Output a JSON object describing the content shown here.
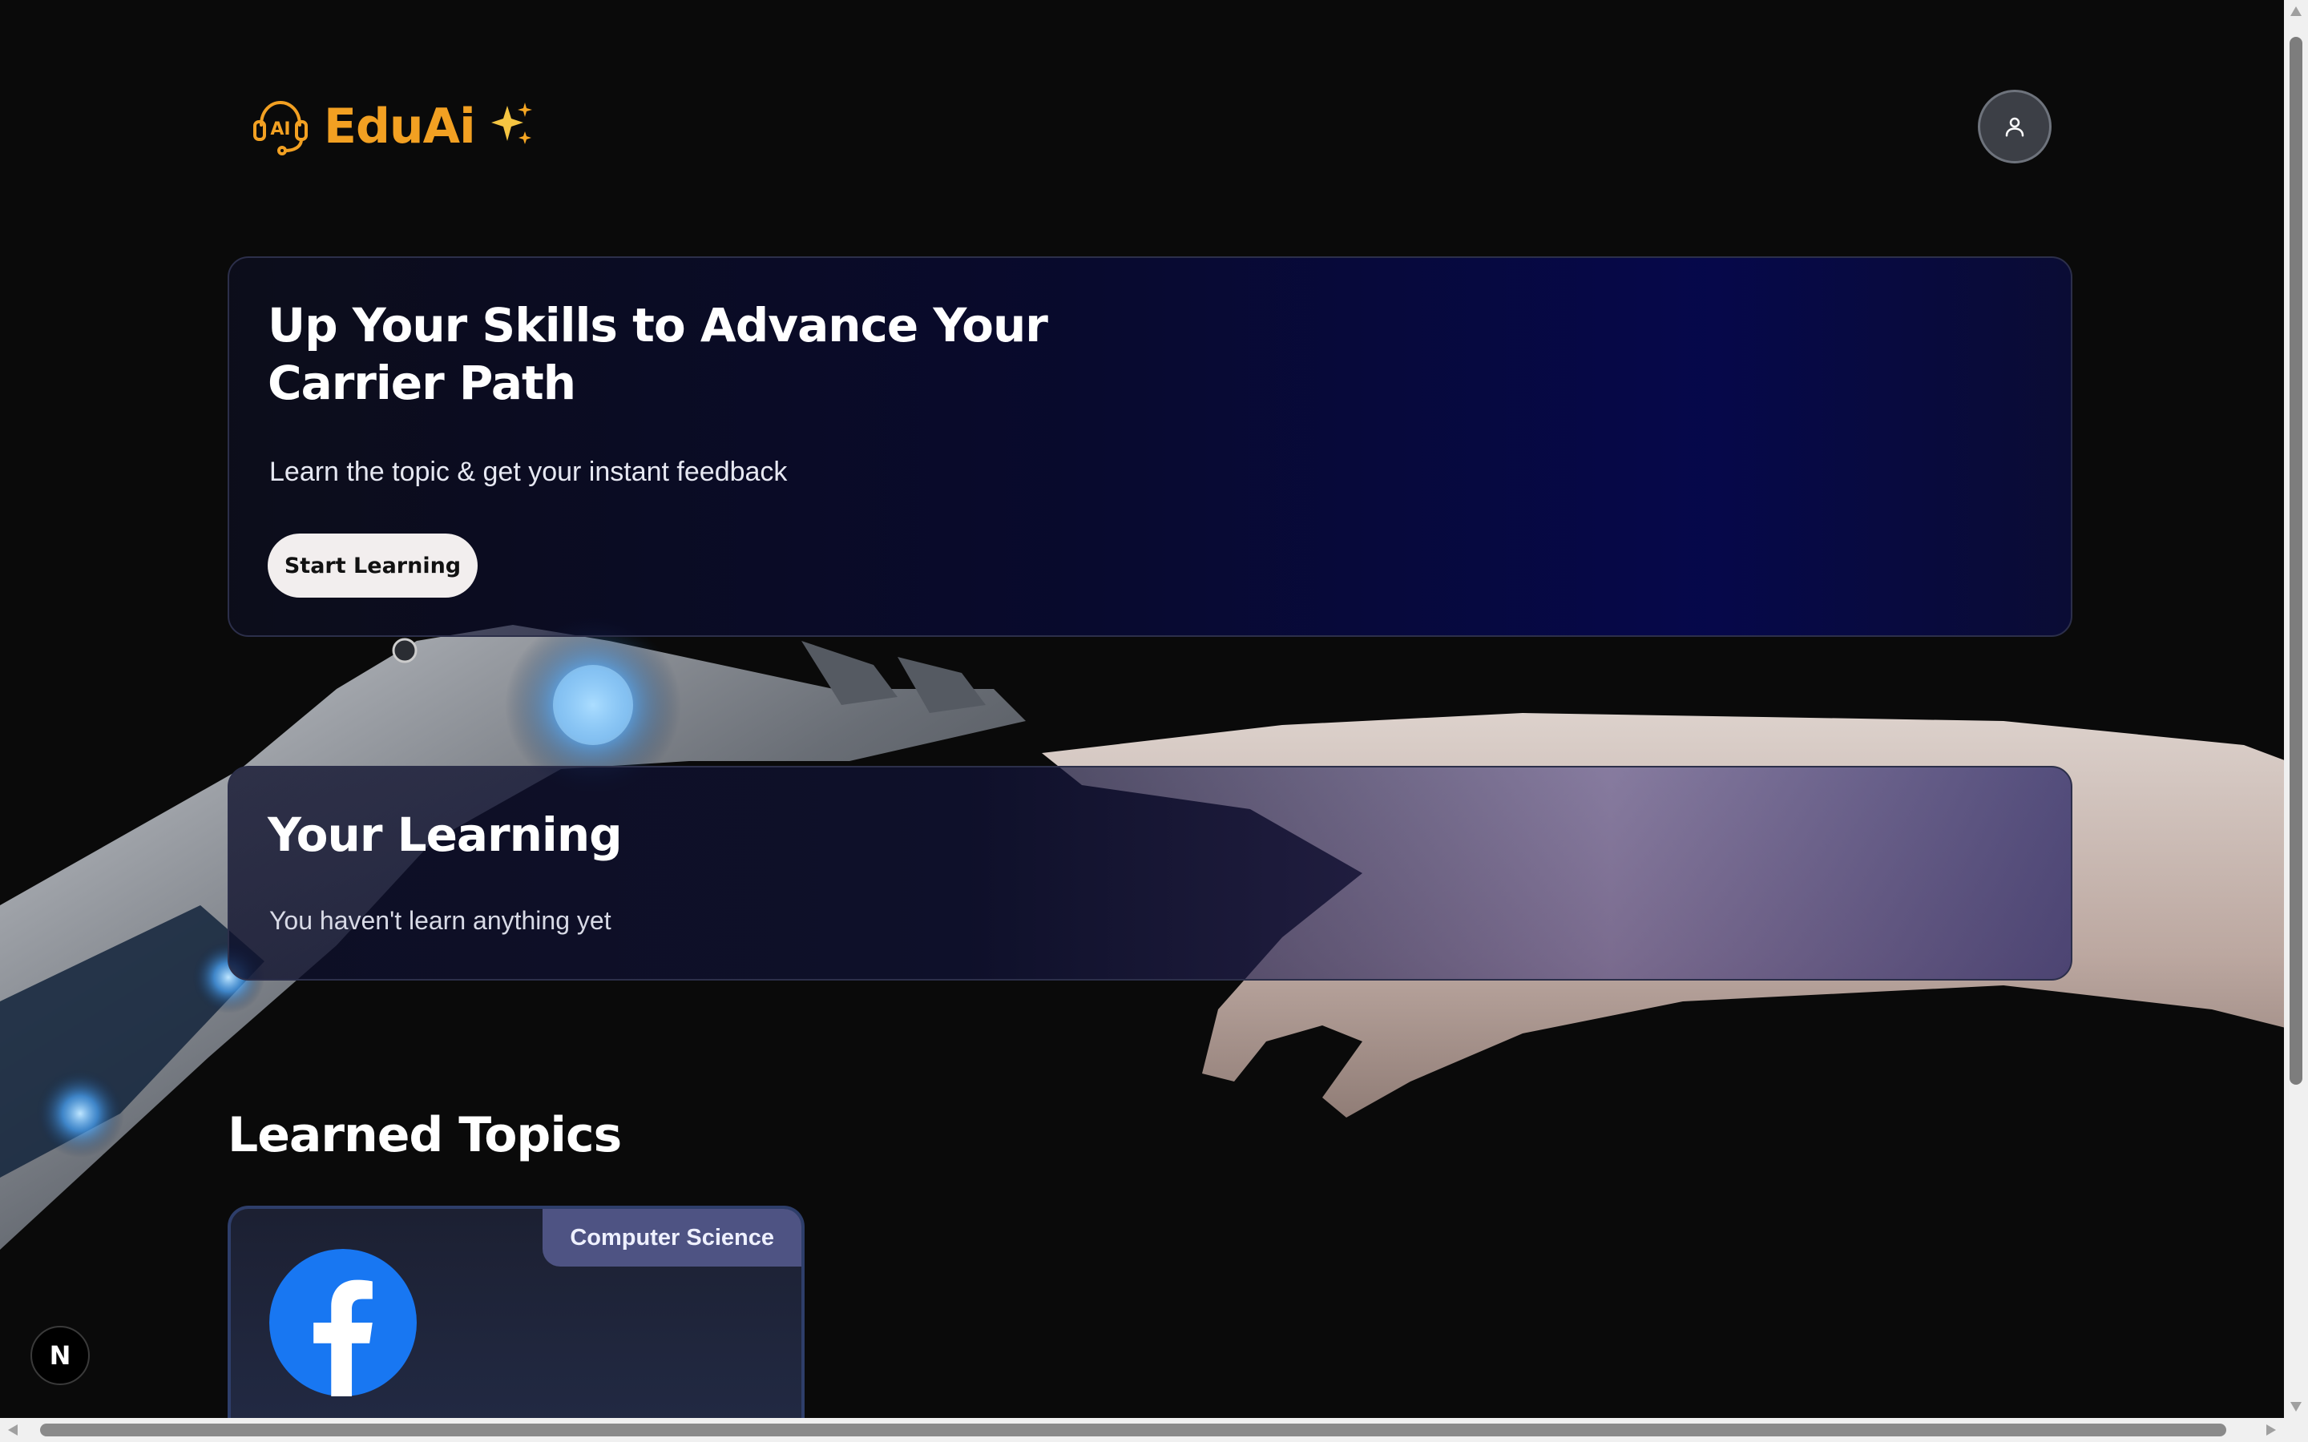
{
  "header": {
    "brand": "EduAi",
    "logo_icon": "ai-headset-icon",
    "brand_color": "#f2a022",
    "avatar_icon": "user-icon"
  },
  "hero": {
    "title": "Up Your Skills to Advance Your Carrier Path",
    "subtitle": "Learn the topic & get your instant feedback",
    "button_label": "Start Learning"
  },
  "learning": {
    "title": "Your Learning",
    "empty_text": "You haven't learn anything yet"
  },
  "topics": {
    "title": "Learned Topics",
    "items": [
      {
        "category": "Computer Science",
        "icon": "facebook-icon"
      }
    ]
  },
  "dev_badge": {
    "label": "N"
  }
}
